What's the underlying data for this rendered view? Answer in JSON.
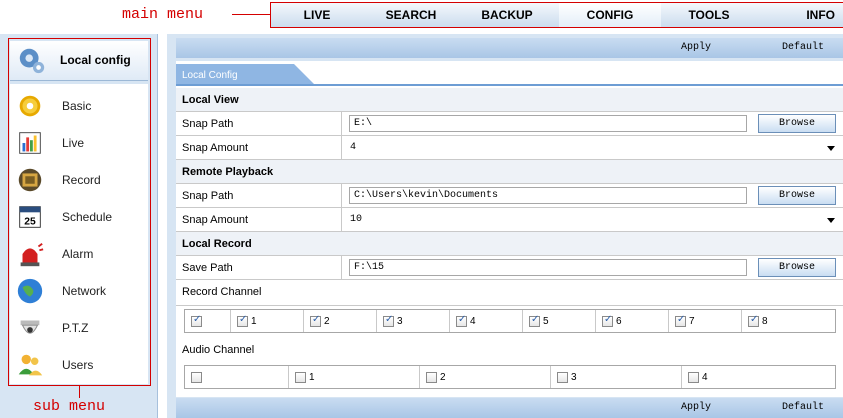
{
  "annotations": {
    "main_menu": "main menu",
    "sub_menu": "sub menu"
  },
  "main_menu": {
    "items": [
      {
        "label": "LIVE"
      },
      {
        "label": "SEARCH"
      },
      {
        "label": "BACKUP"
      },
      {
        "label": "CONFIG",
        "active": true
      },
      {
        "label": "TOOLS"
      },
      {
        "label": "INFO"
      }
    ]
  },
  "sidebar": {
    "header": "Local config",
    "items": [
      {
        "label": "Basic",
        "icon": "gear-icon"
      },
      {
        "label": "Live",
        "icon": "chart-icon"
      },
      {
        "label": "Record",
        "icon": "film-icon"
      },
      {
        "label": "Schedule",
        "icon": "calendar-icon",
        "icon_text": "25"
      },
      {
        "label": "Alarm",
        "icon": "siren-icon"
      },
      {
        "label": "Network",
        "icon": "globe-icon"
      },
      {
        "label": "P.T.Z",
        "icon": "camera-dome-icon"
      },
      {
        "label": "Users",
        "icon": "users-icon"
      }
    ]
  },
  "actions": {
    "apply": "Apply",
    "default": "Default"
  },
  "tab": {
    "label": "Local Config"
  },
  "local_view": {
    "title": "Local View",
    "snap_path_label": "Snap Path",
    "snap_path_value": "E:\\",
    "snap_amount_label": "Snap Amount",
    "snap_amount_value": "4"
  },
  "remote_playback": {
    "title": "Remote Playback",
    "snap_path_label": "Snap Path",
    "snap_path_value": "C:\\Users\\kevin\\Documents",
    "snap_amount_label": "Snap Amount",
    "snap_amount_value": "10"
  },
  "local_record": {
    "title": "Local Record",
    "save_path_label": "Save Path",
    "save_path_value": "F:\\15",
    "record_channel_label": "Record Channel",
    "audio_channel_label": "Audio Channel"
  },
  "browse_label": "Browse",
  "record_channels": [
    {
      "label": "",
      "checked": true
    },
    {
      "label": "1",
      "checked": true
    },
    {
      "label": "2",
      "checked": true
    },
    {
      "label": "3",
      "checked": true
    },
    {
      "label": "4",
      "checked": true
    },
    {
      "label": "5",
      "checked": true
    },
    {
      "label": "6",
      "checked": true
    },
    {
      "label": "7",
      "checked": true
    },
    {
      "label": "8",
      "checked": true
    }
  ],
  "audio_channels": [
    {
      "label": "",
      "checked": false
    },
    {
      "label": "1",
      "checked": false
    },
    {
      "label": "2",
      "checked": false
    },
    {
      "label": "3",
      "checked": false
    },
    {
      "label": "4",
      "checked": false
    }
  ],
  "colors": {
    "annotation": "#d40000",
    "menu_bar": "#cbdcee",
    "panel_bg": "#d7e5f3",
    "accent": "#6d9dd4"
  }
}
